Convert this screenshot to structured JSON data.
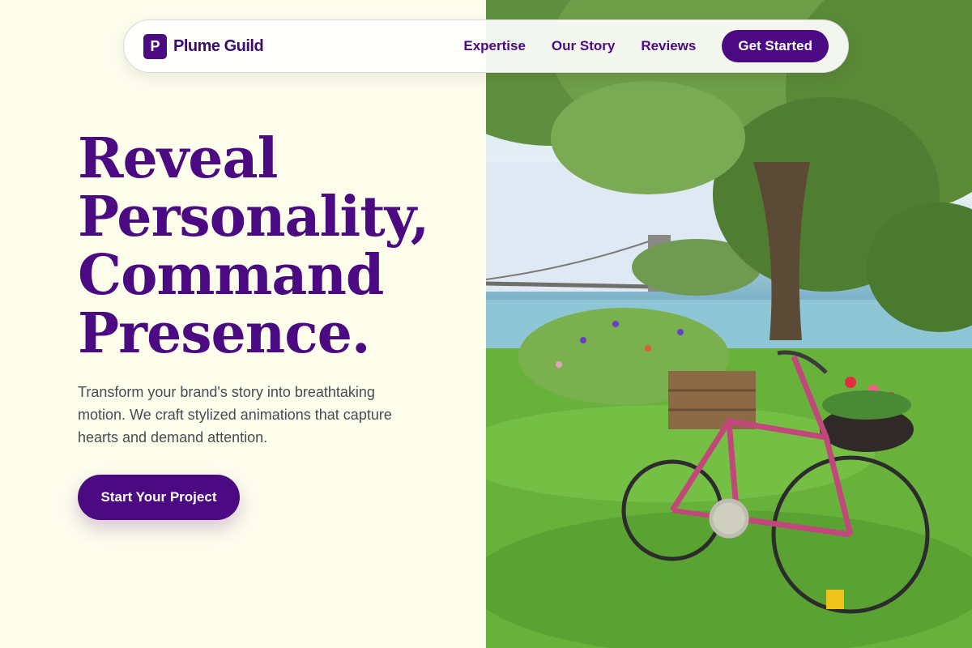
{
  "brand": {
    "logo_letter": "P",
    "name": "Plume Guild"
  },
  "nav": {
    "links": [
      "Expertise",
      "Our Story",
      "Reviews"
    ],
    "cta_label": "Get Started"
  },
  "hero": {
    "title_lines": [
      "Reveal",
      "Personality,",
      "Command",
      "Presence."
    ],
    "subtitle": "Transform your brand's story into breathtaking motion. We craft stylized animations that capture hearts and demand attention.",
    "cta_label": "Start Your Project"
  },
  "colors": {
    "accent": "#4b0a82",
    "page_background": "#fdfdec",
    "body_text": "#4a4a55"
  }
}
